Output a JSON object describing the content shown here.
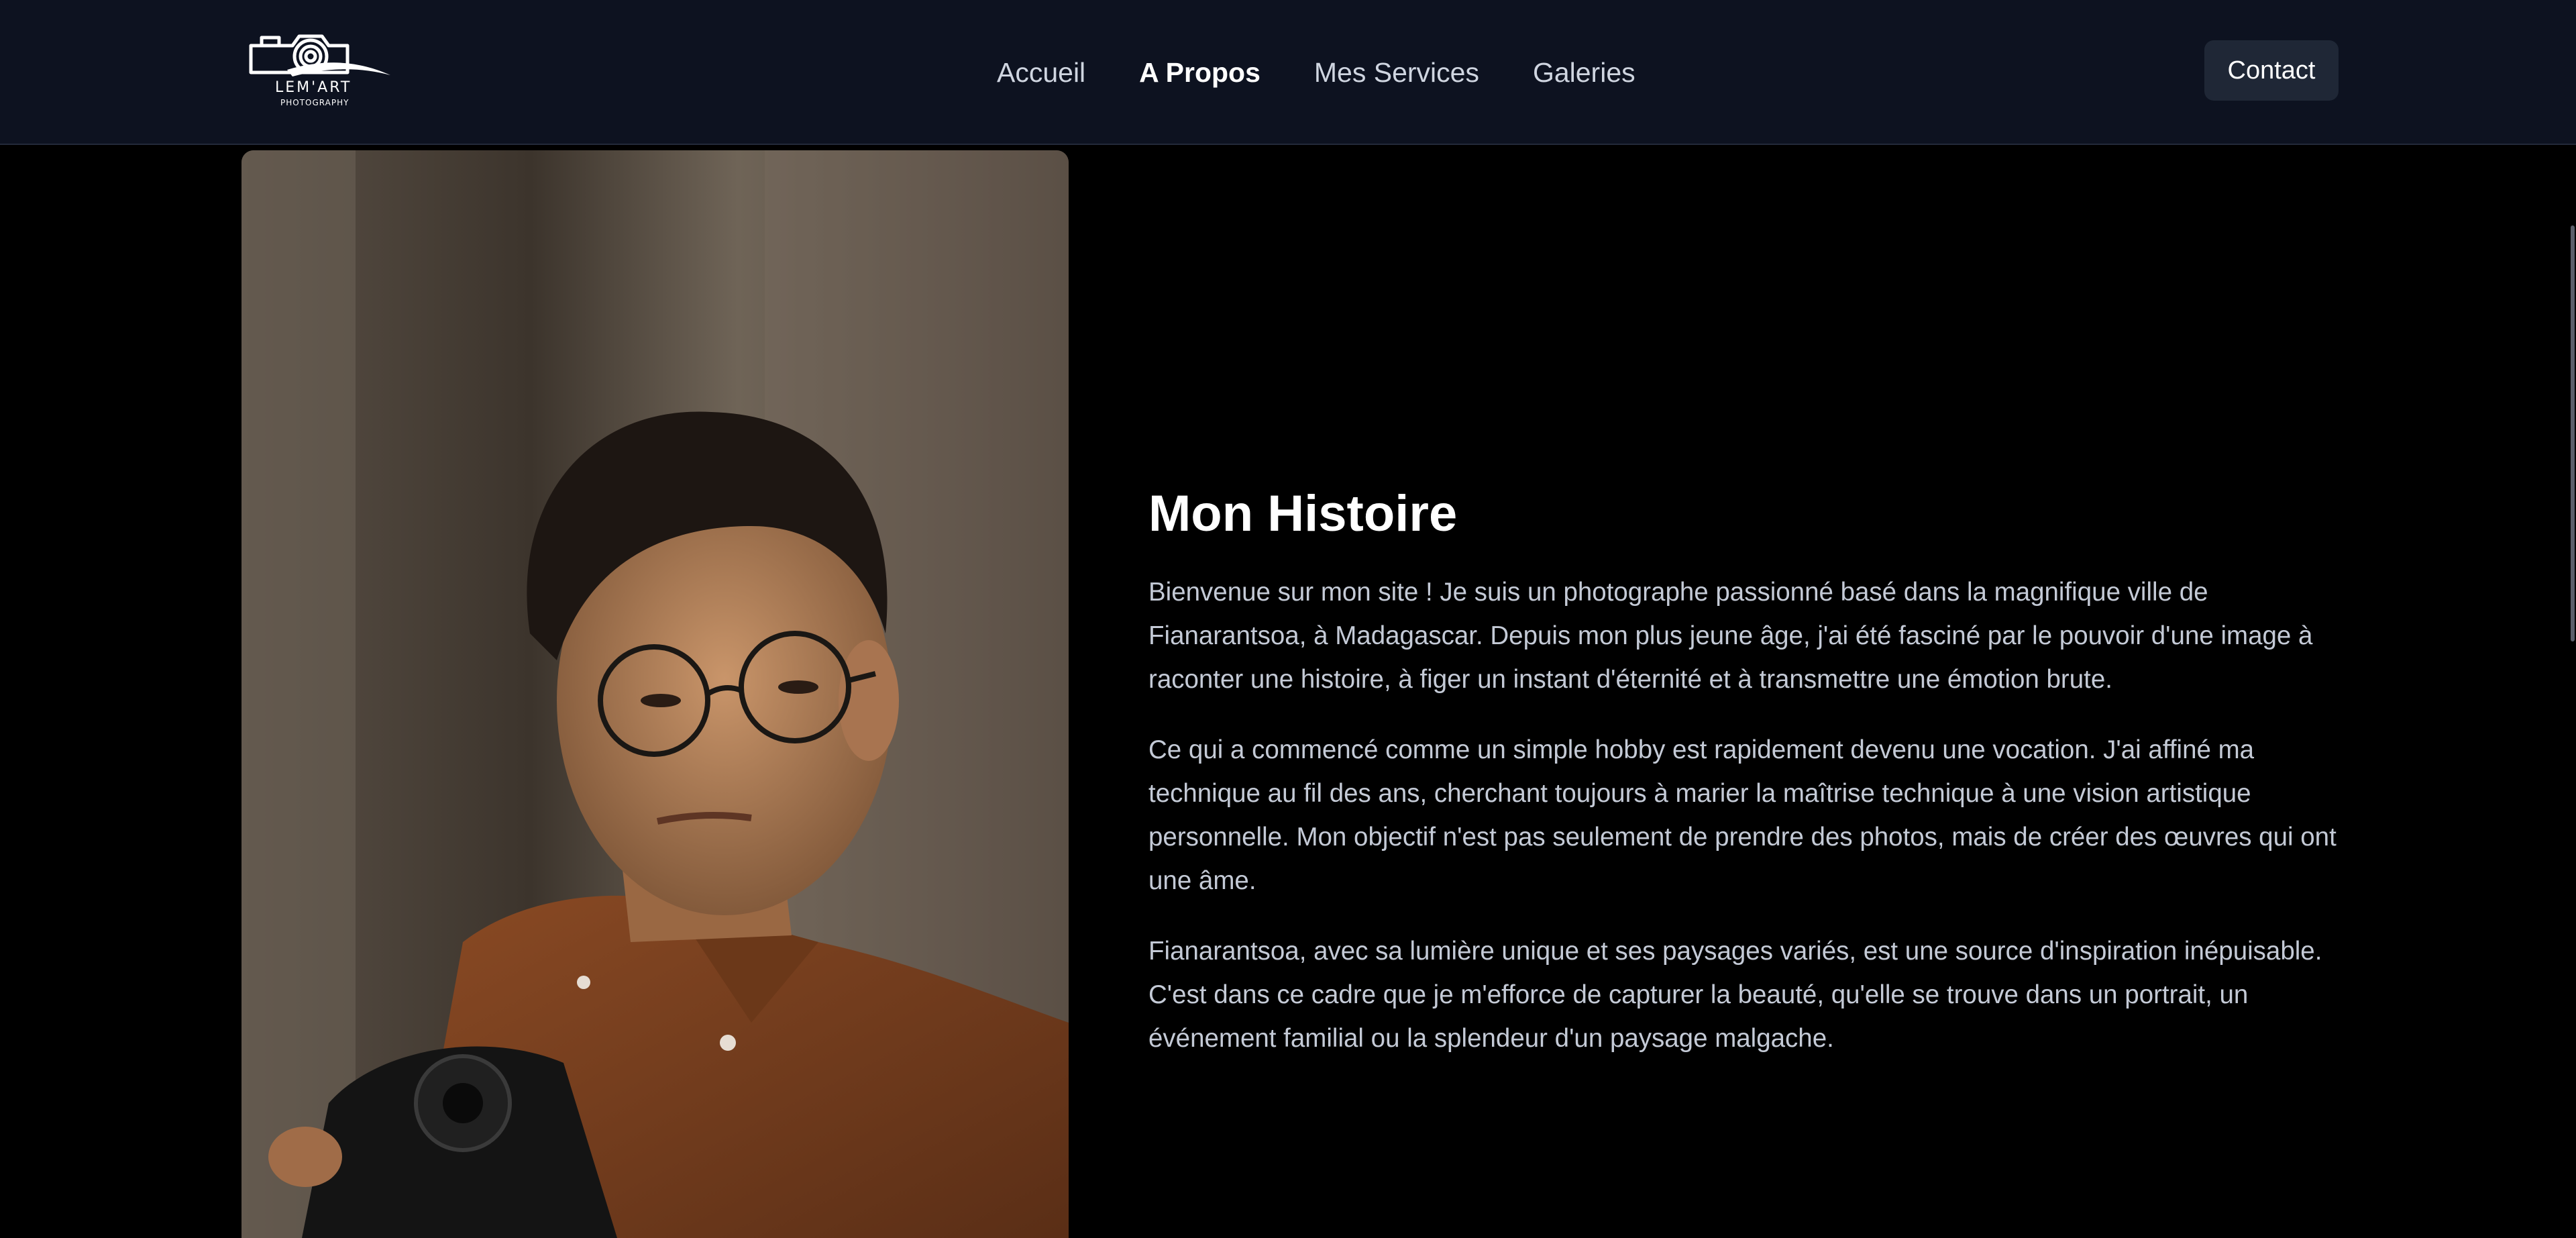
{
  "brand": {
    "name": "LEM'ART",
    "tagline": "PHOTOGRAPHY"
  },
  "nav": {
    "items": [
      {
        "label": "Accueil",
        "active": false
      },
      {
        "label": "A Propos",
        "active": true
      },
      {
        "label": "Mes Services",
        "active": false
      },
      {
        "label": "Galeries",
        "active": false
      }
    ],
    "contact_label": "Contact"
  },
  "about": {
    "title": "Mon Histoire",
    "paragraphs": [
      "Bienvenue sur mon site ! Je suis un photographe passionné basé dans la magnifique ville de Fianarantsoa, à Madagascar. Depuis mon plus jeune âge, j'ai été fasciné par le pouvoir d'une image à raconter une histoire, à figer un instant d'éternité et à transmettre une émotion brute.",
      "Ce qui a commencé comme un simple hobby est rapidement devenu une vocation. J'ai affiné ma technique au fil des ans, cherchant toujours à marier la maîtrise technique à une vision artistique personnelle. Mon objectif n'est pas seulement de prendre des photos, mais de créer des œuvres qui ont une âme.",
      "Fianarantsoa, avec sa lumière unique et ses paysages variés, est une source d'inspiration inépuisable. C'est dans ce cadre que je m'efforce de capturer la beauté, qu'elle se trouve dans un portrait, un événement familial ou la splendeur d'un paysage malgache."
    ]
  },
  "colors": {
    "header_bg": "#0d1220",
    "page_bg": "#000000",
    "text_primary": "#ffffff",
    "text_body": "#c4cad6",
    "button_bg": "#1f2736"
  },
  "icons": {
    "logo": "camera-logo-icon"
  }
}
